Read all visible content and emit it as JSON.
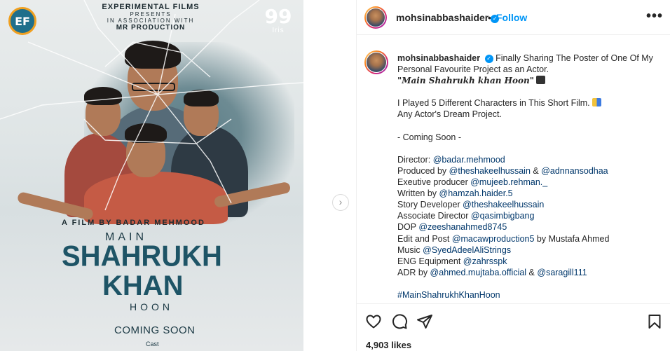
{
  "poster": {
    "presenter": "EXPERIMENTAL FILMS",
    "presents": "PRESENTS",
    "association": "IN ASSOCIATION WITH",
    "coproducer": "MR PRODUCTION",
    "logo_left": "EF",
    "logo_right_mark": "99",
    "logo_right_text": "Iris",
    "film_by": "A FILM BY BADAR MEHMOOD",
    "title_main": "MAIN",
    "title_srk": "SHAHRUKH",
    "title_khan": "KHAN",
    "title_hoon": "HOON",
    "coming_soon": "COMING SOON",
    "cast": "Cast"
  },
  "carousel": {
    "next_icon": "chevron-right-icon",
    "next_glyph": "›"
  },
  "header": {
    "username": "mohsinabbashaider",
    "separator": "•",
    "follow_label": "Follow",
    "more_label": "•••"
  },
  "caption": {
    "username": "mohsinabbashaider",
    "intro_1": "Finally Sharing The Poster of One Of My",
    "intro_2": "Personal Favourite Project as an Actor.",
    "film_title": "\"Main Shahrukh khan Hoon\"",
    "played": "I Played 5 Different Characters in This Short Film.",
    "dream": "Any Actor's Dream Project.",
    "coming": "- Coming Soon -",
    "credits": [
      {
        "prefix": "Director: ",
        "tag": "@badar.mehmood"
      },
      {
        "prefix": "Produced by ",
        "tag": "@theshakeelhussain",
        "mid": " & ",
        "tag2": "@adnnansodhaa"
      },
      {
        "prefix": "Exeutive producer ",
        "tag": "@mujeeb.rehman._"
      },
      {
        "prefix": "Written by ",
        "tag": "@hamzah.haider.5"
      },
      {
        "prefix": "Story Developer ",
        "tag": "@theshakeelhussain"
      },
      {
        "prefix": "Associate Director ",
        "tag": "@qasimbigbang"
      },
      {
        "prefix": "DOP ",
        "tag": "@zeeshanahmed8745"
      },
      {
        "prefix": "Edit and Post ",
        "tag": "@macawproduction5",
        "mid": " by Mustafa Ahmed"
      },
      {
        "prefix": "Music ",
        "tag": "@SyedAdeelAliStrings"
      },
      {
        "prefix": "ENG Equipment ",
        "tag": "@zahrsspk"
      },
      {
        "prefix": "ADR by ",
        "tag": "@ahmed.mujtaba.official",
        "mid": " & ",
        "tag2": "@saragill111"
      }
    ],
    "hashtag": "#MainShahrukhKhanHoon"
  },
  "actions": {
    "like_icon": "heart-icon",
    "comment_icon": "comment-icon",
    "share_icon": "share-icon",
    "save_icon": "bookmark-icon"
  },
  "likes": "4,903 likes",
  "colors": {
    "accent": "#0095f6",
    "tag": "#00376b",
    "title_blue": "#1e5466"
  }
}
